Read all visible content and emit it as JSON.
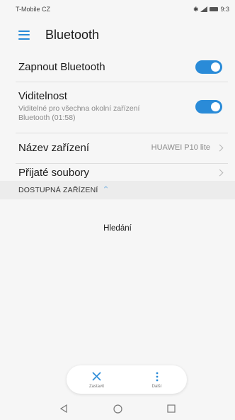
{
  "status_bar": {
    "carrier": "T-Mobile CZ",
    "time": "9:3"
  },
  "app_bar": {
    "title": "Bluetooth",
    "menu_icon": "hamburger-menu-icon"
  },
  "settings": {
    "bluetooth_toggle": {
      "label": "Zapnout Bluetooth",
      "on": true
    },
    "visibility": {
      "label": "Viditelnost",
      "sub_line1": "Viditelné pro všechna okolní zařízení",
      "sub_line2": "Bluetooth (01:58)",
      "on": true
    },
    "device_name": {
      "label": "Název zařízení",
      "value": "HUAWEI P10 lite"
    },
    "received_files": {
      "label": "Přijaté soubory"
    }
  },
  "available_devices": {
    "header": "DOSTUPNÁ ZAŘÍZENÍ",
    "status": "Hledání"
  },
  "bottom_actions": {
    "stop": {
      "label": "Zastavit",
      "icon": "close-icon"
    },
    "more": {
      "label": "Další",
      "icon": "more-vertical-icon"
    }
  },
  "colors": {
    "accent": "#2a8bd8",
    "background": "#f6f6f6",
    "section_header": "#ececec"
  }
}
